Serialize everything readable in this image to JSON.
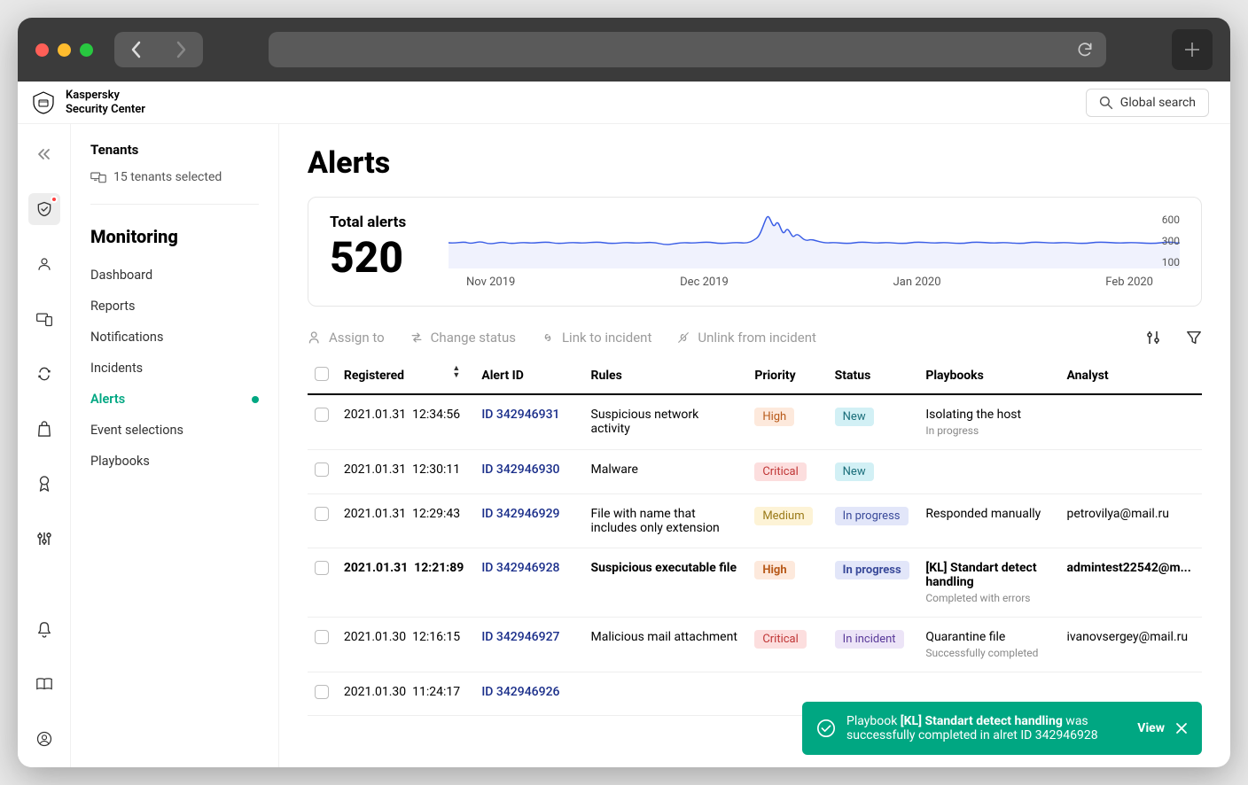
{
  "brand": {
    "line1": "Kaspersky",
    "line2": "Security Center"
  },
  "search": {
    "label": "Global search"
  },
  "tenants": {
    "title": "Tenants",
    "selected": "15 tenants selected"
  },
  "sidebar": {
    "section": "Monitoring",
    "items": [
      {
        "label": "Dashboard",
        "active": false
      },
      {
        "label": "Reports",
        "active": false
      },
      {
        "label": "Notifications",
        "active": false
      },
      {
        "label": "Incidents",
        "active": false
      },
      {
        "label": "Alerts",
        "active": true
      },
      {
        "label": "Event selections",
        "active": false
      },
      {
        "label": "Playbooks",
        "active": false
      }
    ]
  },
  "page": {
    "title": "Alerts"
  },
  "chart_data": {
    "type": "line",
    "title": "Total alerts",
    "total": "520",
    "x_ticks": [
      "Nov 2019",
      "Dec 2019",
      "Jan 2020",
      "Feb 2020"
    ],
    "y_ticks": [
      "600",
      "300",
      "100"
    ],
    "ylim": [
      0,
      650
    ],
    "series": [
      {
        "name": "alerts",
        "approx_baseline": 300,
        "peak": 600,
        "peak_x": "mid Dec 2019"
      }
    ]
  },
  "toolbar": {
    "assign": "Assign to",
    "change_status": "Change status",
    "link": "Link to incident",
    "unlink": "Unlink from incident"
  },
  "columns": {
    "registered": "Registered",
    "alert_id": "Alert ID",
    "rules": "Rules",
    "priority": "Priority",
    "status": "Status",
    "playbooks": "Playbooks",
    "analyst": "Analyst"
  },
  "rows": [
    {
      "registered_date": "2021.01.31",
      "registered_time": "12:34:56",
      "id": "ID 342946931",
      "rule": "Suspicious network activity",
      "priority": "High",
      "priority_cls": "high",
      "status": "New",
      "status_cls": "new",
      "playbook": "Isolating the host",
      "playbook_sub": "In progress",
      "analyst": "",
      "bold": false
    },
    {
      "registered_date": "2021.01.31",
      "registered_time": "12:30:11",
      "id": "ID 342946930",
      "rule": "Malware",
      "priority": "Critical",
      "priority_cls": "critical",
      "status": "New",
      "status_cls": "new",
      "playbook": "",
      "playbook_sub": "",
      "analyst": "",
      "bold": false
    },
    {
      "registered_date": "2021.01.31",
      "registered_time": "12:29:43",
      "id": "ID 342946929",
      "rule": "File with name that includes only extension",
      "priority": "Medium",
      "priority_cls": "medium",
      "status": "In progress",
      "status_cls": "progress",
      "playbook": "Responded manually",
      "playbook_sub": "",
      "analyst": "petrovilya@mail.ru",
      "bold": false
    },
    {
      "registered_date": "2021.01.31",
      "registered_time": "12:21:89",
      "id": "ID 342946928",
      "rule": "Suspicious executable file",
      "priority": "High",
      "priority_cls": "high",
      "status": "In progress",
      "status_cls": "progress",
      "playbook": "[KL] Standart detect handling",
      "playbook_sub": "Completed with errors",
      "analyst": "admintest22542@m...",
      "bold": true
    },
    {
      "registered_date": "2021.01.30",
      "registered_time": "12:16:15",
      "id": "ID 342946927",
      "rule": "Malicious mail attachment",
      "priority": "Critical",
      "priority_cls": "critical",
      "status": "In incident",
      "status_cls": "incident",
      "playbook": "Quarantine file",
      "playbook_sub": "Successfully completed",
      "analyst": "ivanovsergey@mail.ru",
      "bold": false
    },
    {
      "registered_date": "2021.01.30",
      "registered_time": "11:24:17",
      "id": "ID 342946926",
      "rule": "",
      "priority": "",
      "priority_cls": "",
      "status": "",
      "status_cls": "",
      "playbook": "",
      "playbook_sub": "",
      "analyst": "",
      "bold": false
    }
  ],
  "toast": {
    "prefix": "Playbook ",
    "bold": "[KL] Standart detect handling",
    "suffix": " was successfully completed in alret ID 342946928",
    "view": "View"
  }
}
